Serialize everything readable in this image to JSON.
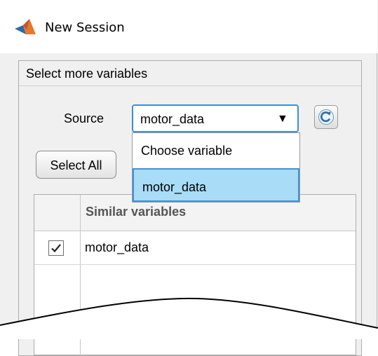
{
  "window": {
    "title": "New Session",
    "app_icon": "matlab-logo-icon"
  },
  "panel": {
    "title": "Select more variables"
  },
  "source": {
    "label": "Source",
    "selected_value": "motor_data",
    "arrow_icon": "dropdown-arrow-icon",
    "options": [
      {
        "label": "Choose variable",
        "highlighted": false
      },
      {
        "label": "motor_data",
        "highlighted": true
      }
    ]
  },
  "refresh": {
    "icon": "refresh-icon"
  },
  "select_all": {
    "label": "Select All"
  },
  "table": {
    "header": "Similar variables",
    "rows": [
      {
        "checked": true,
        "label": "motor_data"
      }
    ]
  },
  "colors": {
    "selection_fill": "#a9dcf7",
    "selection_border": "#3f92d6",
    "panel_background": "#f0f0f0"
  }
}
